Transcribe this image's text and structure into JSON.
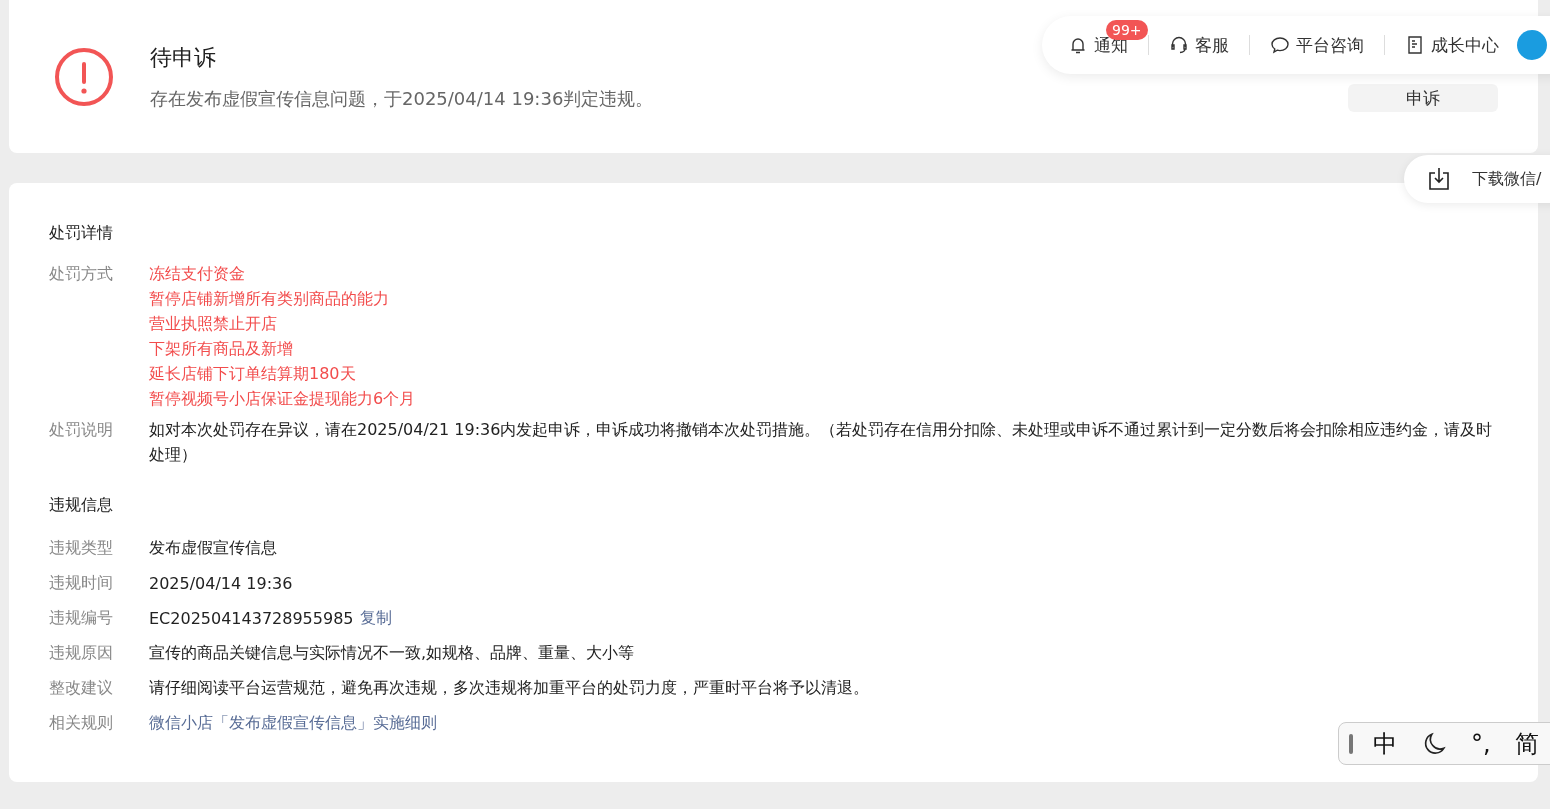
{
  "status": {
    "title": "待申诉",
    "description": "存在发布虚假宣传信息问题，于2025/04/14 19:36判定违规。",
    "appeal_button": "申诉"
  },
  "toolbar": {
    "items": [
      {
        "kind": "bell",
        "label": "通知",
        "badge": "99+"
      },
      {
        "kind": "headset",
        "label": "客服"
      },
      {
        "kind": "chat",
        "label": "平台咨询"
      },
      {
        "kind": "doc",
        "label": "成长中心"
      }
    ]
  },
  "download": {
    "label": "下载微信/"
  },
  "penalty": {
    "title": "处罚详情",
    "methods_label": "处罚方式",
    "methods": [
      "冻结支付资金",
      "暂停店铺新增所有类别商品的能力",
      "营业执照禁止开店",
      "下架所有商品及新增",
      "延长店铺下订单结算期180天",
      "暂停视频号小店保证金提现能力6个月"
    ],
    "note_label": "处罚说明",
    "note": "如对本次处罚存在异议，请在2025/04/21 19:36内发起申诉，申诉成功将撤销本次处罚措施。（若处罚存在信用分扣除、未处理或申诉不通过累计到一定分数后将会扣除相应违约金，请及时处理）"
  },
  "violation": {
    "title": "违规信息",
    "rows": [
      {
        "label": "违规类型",
        "kind": "text",
        "value": "发布虚假宣传信息"
      },
      {
        "label": "违规时间",
        "kind": "text",
        "value": "2025/04/14 19:36"
      },
      {
        "label": "违规编号",
        "kind": "text",
        "value": "EC202504143728955985",
        "link": "复制"
      },
      {
        "label": "违规原因",
        "kind": "text",
        "value": "宣传的商品关键信息与实际情况不一致,如规格、品牌、重量、大小等"
      },
      {
        "label": "整改建议",
        "kind": "text",
        "value": "请仔细阅读平台运营规范，避免再次违规，多次违规将加重平台的处罚力度，严重时平台将予以清退。"
      },
      {
        "label": "相关规则",
        "kind": "link",
        "value": "微信小店「发布虚假宣传信息」实施细则"
      }
    ]
  },
  "ime": {
    "language": "中",
    "punctuation": "°,",
    "script": "简"
  }
}
